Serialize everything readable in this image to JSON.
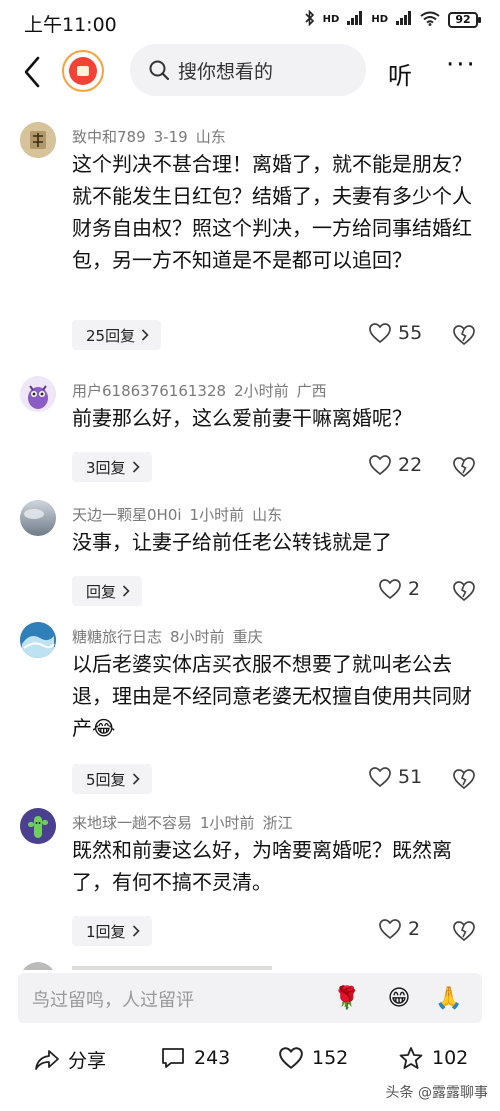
{
  "status_bar": {
    "time": "上午11:00",
    "battery": "92",
    "signal_label_1": "HD",
    "signal_label_2": "HD"
  },
  "top_bar": {
    "search_placeholder": "搜你想看的",
    "listen_label": "听",
    "more_label": "···"
  },
  "comments": [
    {
      "user": "致中和789",
      "date": "3-19",
      "location": "山东",
      "text": "这个判决不甚合理！离婚了，就不能是朋友？就不能发生日红包？结婚了，夫妻有多少个人财务自由权？照这个判决，一方给同事结婚红包，另一方不知道是不是都可以追回？",
      "replies": "25回复",
      "likes": "55"
    },
    {
      "user": "用户6186376161328",
      "date": "2小时前",
      "location": "广西",
      "text": "前妻那么好，这么爱前妻干嘛离婚呢？",
      "replies": "3回复",
      "likes": "22"
    },
    {
      "user": "天边一颗星0H0i",
      "date": "1小时前",
      "location": "山东",
      "text": "没事，让妻子给前任老公转钱就是了",
      "replies": "回复",
      "likes": "2"
    },
    {
      "user": "糖糖旅行日志",
      "date": "8小时前",
      "location": "重庆",
      "text": "以后老婆实体店买衣服不想要了就叫老公去退，理由是不经同意老婆无权擅自使用共同财产😂",
      "replies": "5回复",
      "likes": "51"
    },
    {
      "user": "来地球一趟不容易",
      "date": "1小时前",
      "location": "浙江",
      "text": "既然和前妻这么好，为啥要离婚呢？既然离了，有何不搞不灵清。",
      "replies": "1回复",
      "likes": "2"
    }
  ],
  "input_bar": {
    "placeholder": "鸟过留鸣，人过留评",
    "emojis": [
      "🌹",
      "😁",
      "🙏"
    ]
  },
  "bottom_bar": {
    "share": "分享",
    "comments": "243",
    "likes": "152",
    "favorites": "102"
  },
  "watermark": "头条 @露露聊事",
  "colors": {
    "accent_orange": "#f7a23a",
    "text_primary": "#111111",
    "text_meta": "#7a7a7a",
    "chip_bg": "#f3f3f5"
  }
}
